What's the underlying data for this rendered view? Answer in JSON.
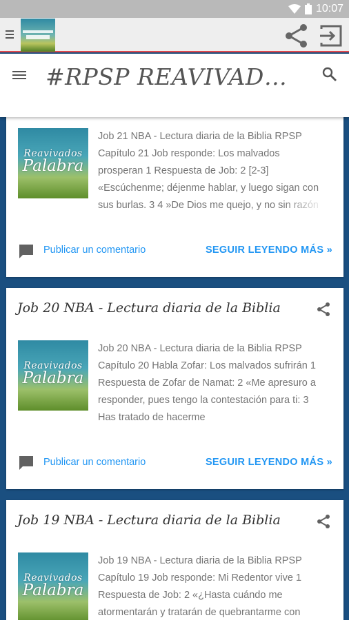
{
  "status_bar": {
    "time": "10:07",
    "icons": [
      "wifi-icon",
      "battery-icon"
    ]
  },
  "app_bar": {
    "icons": [
      "menu-icon",
      "app-logo",
      "share-icon",
      "exit-icon"
    ],
    "accent_color": "#e0474c"
  },
  "blog": {
    "title": "#RPSP REAVIVADOS POR SU PALABRA",
    "icons": [
      "menu-icon",
      "search-icon"
    ]
  },
  "thumbnail": {
    "line1": "Reavivados",
    "line2": "Palabra"
  },
  "posts": [
    {
      "title": "",
      "snippet": "Job 21 NBA - Lectura diaria de la Biblia RPSP Capítulo 21 Job responde: Los malvados prosperan 1  Respuesta de Job: 2  [2-3] «Escúchenme; déjenme hablar, y luego sigan con sus burlas. 3 4  »De Dios me quejo, y no sin razón",
      "comment_label": "Publicar un comentario",
      "read_more_label": "SEGUIR LEYENDO MÁS »"
    },
    {
      "title": "Job 20 NBA - Lectura diaria de la Biblia",
      "snippet": "Job 20 NBA - Lectura diaria de la Biblia RPSP Capítulo 20 Habla Zofar: Los malvados sufrirán 1  Respuesta de Zofar de Namat: 2  «Me apresuro a responder, pues tengo la contestación para ti: 3  Has tratado de hacerme",
      "comment_label": "Publicar un comentario",
      "read_more_label": "SEGUIR LEYENDO MÁS »"
    },
    {
      "title": "Job 19 NBA - Lectura diaria de la Biblia",
      "snippet": "Job 19 NBA - Lectura diaria de la Biblia RPSP Capítulo 19 Job responde: Mi Redentor vive 1  Respuesta de Job: 2  «¿Hasta cuándo me atormentarán y tratarán de quebrantarme con",
      "comment_label": "Publicar un comentario",
      "read_more_label": "SEGUIR LEYENDO MÁS »"
    }
  ],
  "colors": {
    "background": "#1a4f80",
    "link": "#2196f3",
    "status_bar": "#b9b9b9"
  }
}
